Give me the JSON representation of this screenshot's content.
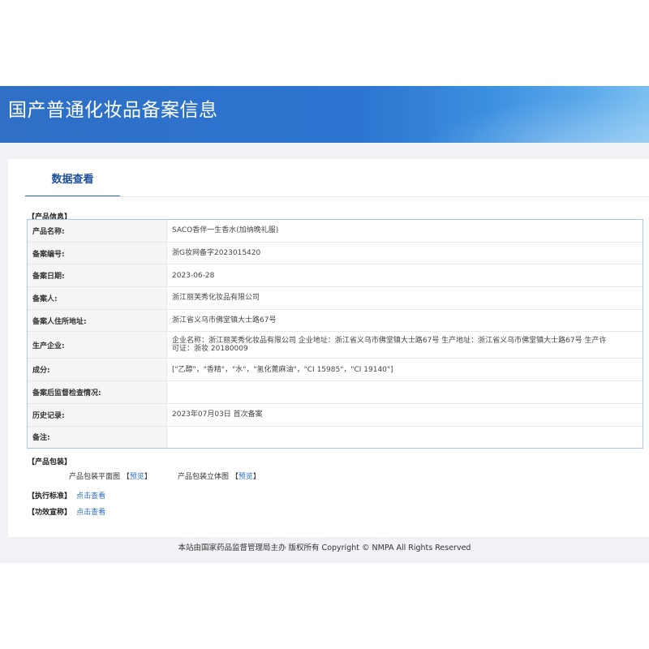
{
  "banner": {
    "title": "国产普通化妆品备案信息"
  },
  "tabs": [
    {
      "label": "数据查看"
    }
  ],
  "product_info": {
    "section_label": "【产品信息】",
    "rows": [
      {
        "key": "产品名称:",
        "value": "SACO香伴一生香水(加纳晚礼服)"
      },
      {
        "key": "备案编号:",
        "value": "浙G妆网备字2023015420"
      },
      {
        "key": "备案日期:",
        "value": "2023-06-28"
      },
      {
        "key": "备案人:",
        "value": "浙江丽芙秀化妆品有限公司"
      },
      {
        "key": "备案人住所地址:",
        "value": "浙江省义乌市佛堂镇大士路67号"
      },
      {
        "key": "生产企业:",
        "value": "企业名称：浙江丽芙秀化妆品有限公司 企业地址：浙江省义乌市佛堂镇大士路67号 生产地址：浙江省义乌市佛堂镇大士路67号 生产许可证：浙妆 20180009"
      },
      {
        "key": "成分:",
        "value": "[\"乙醇\"，\"香精\"，\"水\"，\"氢化蓖麻油\"，\"CI 15985\"，\"CI 19140\"]"
      },
      {
        "key": "备案后监督检查情况:",
        "value": ""
      },
      {
        "key": "历史记录:",
        "value": "2023年07月03日 首次备案"
      },
      {
        "key": "备注:",
        "value": ""
      }
    ]
  },
  "packaging": {
    "section_label": "【产品包装】",
    "flat_label": "产品包装平面图",
    "flat_preview_open": "【",
    "flat_preview_link": "预览",
    "flat_preview_close": "】",
    "solid_label": "产品包装立体图",
    "solid_preview_open": "【",
    "solid_preview_link": "预览",
    "solid_preview_close": "】"
  },
  "standard": {
    "label": "【执行标准】",
    "link": "点击查看"
  },
  "efficacy": {
    "label": "【功效宣称】",
    "link": "点击查看"
  },
  "footer": {
    "text": "本站由国家药品监督管理局主办 版权所有 Copyright © NMPA All Rights Reserved"
  }
}
